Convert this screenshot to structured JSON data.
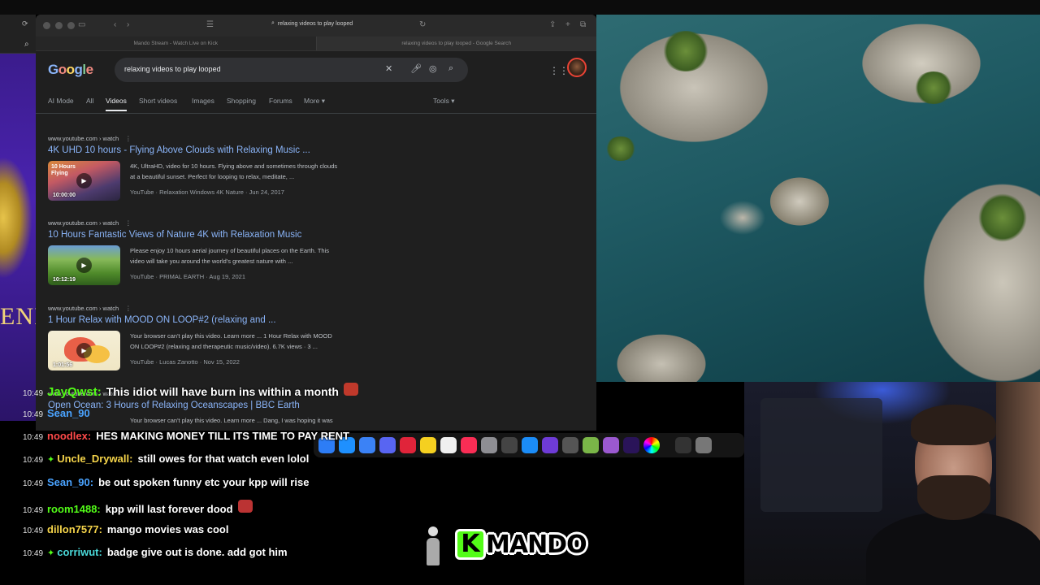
{
  "browser": {
    "url": "relaxing videos to play looped",
    "tabs": [
      "Mando Stream - Watch Live on Kick",
      "relaxing videos to play looped - Google Search"
    ]
  },
  "google": {
    "query": "relaxing videos to play looped",
    "nav": [
      "AI Mode",
      "All",
      "Videos",
      "Short videos",
      "Images",
      "Shopping",
      "Forums",
      "More ▾",
      "Tools ▾"
    ],
    "results": [
      {
        "site": "www.youtube.com › watch",
        "title": "4K UHD 10 hours - Flying Above Clouds with Relaxing Music ...",
        "snippet_line1": "4K, UltraHD, video for 10 hours. Flying above and sometimes through clouds",
        "snippet_line2": "at a beautiful sunset. Perfect for looping to relax, meditate, ...",
        "meta": "YouTube · Relaxation Windows 4K Nature · Jun 24, 2017",
        "duration": "10:00:00",
        "thumb_text": "10 Hours Flying"
      },
      {
        "site": "www.youtube.com › watch",
        "title": "10 Hours Fantastic Views of Nature 4K with Relaxation Music",
        "snippet_line1": "Please enjoy 10 hours aerial journey of beautiful places on the Earth. This",
        "snippet_line2": "video will take you around the world's greatest nature with ...",
        "meta": "YouTube · PRIMAL EARTH · Aug 19, 2021",
        "duration": "10:12:19"
      },
      {
        "site": "www.youtube.com › watch",
        "title": "1 Hour Relax with MOOD ON LOOP#2 (relaxing and ...",
        "snippet_line1": "Your browser can't play this video. Learn more ... 1 Hour Relax with MOOD",
        "snippet_line2": "ON LOOP#2 (relaxing and therapeutic music/video). 6.7K views · 3 ...",
        "meta": "YouTube · Lucas Zanotto · Nov 15, 2022",
        "duration": "1:01:56"
      },
      {
        "site": "www.youtube.com › watch",
        "title": "Open Ocean: 3 Hours of Relaxing Oceanscapes | BBC Earth",
        "snippet_line1": "Your browser can't play this video. Learn more ... Dang, I was hoping it was"
      }
    ]
  },
  "stream_left": {
    "letters": "ENI"
  },
  "chat": [
    {
      "time": "10:49",
      "user": "JayQwst",
      "color": "#53fc18",
      "msg": "This idiot will have burn ins within a month",
      "emote": "#c0392b"
    },
    {
      "time": "10:49",
      "user": "Sean_90",
      "color": "#4aa3ff",
      "msg": ""
    },
    {
      "time": "10:49",
      "user": "noodlex",
      "color": "#ff4a4a",
      "msg": "HES MAKING MONEY TILL ITS TIME TO PAY RENT"
    },
    {
      "time": "10:49",
      "user": "Uncle_Drywall",
      "color": "#f5d44a",
      "msg": "still owes for that watch even lolol",
      "badge": true
    },
    {
      "time": "10:49",
      "user": "Sean_90",
      "color": "#4aa3ff",
      "msg": "be out spoken funny etc your kpp will rise"
    },
    {
      "time": "10:49",
      "user": "room1488",
      "color": "#53fc18",
      "msg": "kpp will last forever dood",
      "emote": "#b33"
    },
    {
      "time": "10:49",
      "user": "dillon7577",
      "color": "#f5d44a",
      "msg": "mango movies was cool"
    },
    {
      "time": "10:49",
      "user": "corriwut",
      "color": "#4ad9d9",
      "msg": "badge give out is done. add got him",
      "badge": true
    }
  ],
  "branding": {
    "k": "K",
    "word": "MANDO"
  },
  "colors": {
    "kick_green": "#53fc18",
    "link_blue": "#8ab4f8"
  }
}
